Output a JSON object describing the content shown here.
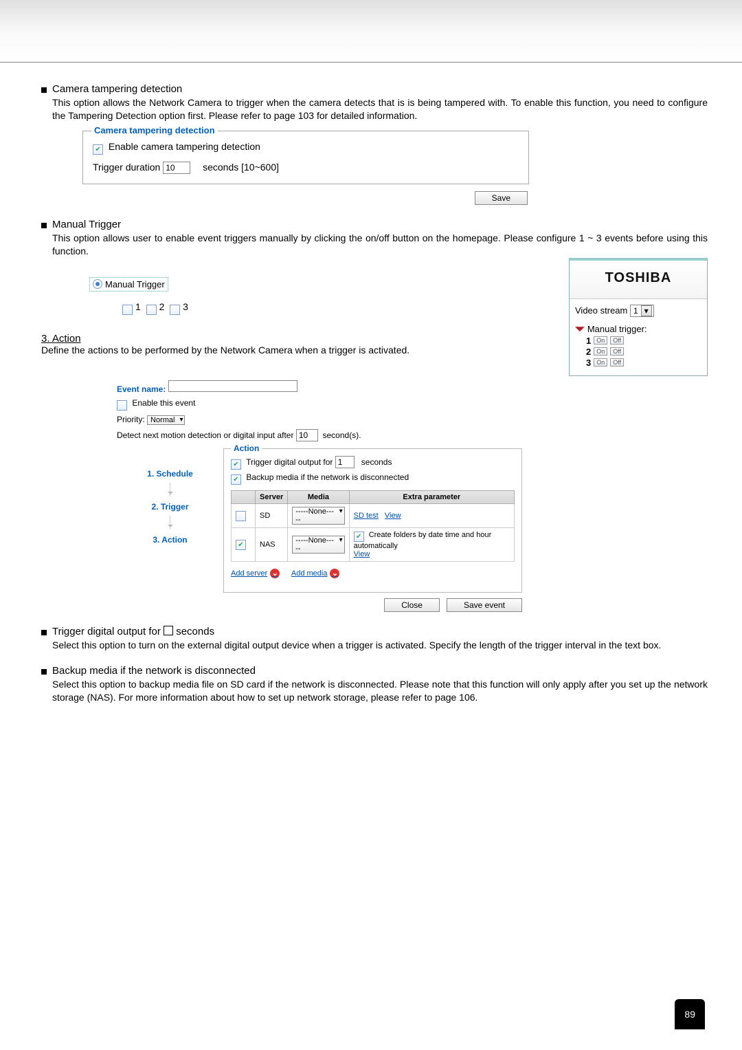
{
  "top_section": {
    "title": "Camera tampering detection",
    "body": "This option allows the Network Camera to trigger when the camera detects that is is being tampered with. To enable this function, you need to configure the Tampering Detection option first. Please refer to page 103 for detailed information."
  },
  "tampering_box": {
    "legend": "Camera tampering detection",
    "enable_label": "Enable camera tampering detection",
    "enable_checked": true,
    "duration_label": "Trigger duration",
    "duration_value": "10",
    "duration_suffix": "seconds [10~600]",
    "save_label": "Save"
  },
  "manual_trigger": {
    "title": "Manual Trigger",
    "body": "This option allows user to enable event triggers manually by clicking the on/off button on the homepage. Please configure 1 ~ 3 events before using this function.",
    "radio_label": "Manual Trigger",
    "numbers": [
      "1",
      "2",
      "3"
    ]
  },
  "action_section": {
    "heading": "3. Action",
    "body": "Define the actions to be performed by the Network Camera when a trigger is activated."
  },
  "side_panel": {
    "brand": "TOSHIBA",
    "video_stream_label": "Video stream",
    "video_stream_value": "1",
    "mt_label": "Manual trigger:",
    "rows": [
      {
        "n": "1",
        "on": "On",
        "off": "Off"
      },
      {
        "n": "2",
        "on": "On",
        "off": "Off"
      },
      {
        "n": "3",
        "on": "On",
        "off": "Off"
      }
    ]
  },
  "event": {
    "name_label": "Event name:",
    "name_value": "",
    "enable_label": "Enable this event",
    "priority_label": "Priority:",
    "priority_value": "Normal",
    "detect_label_pre": "Detect next motion detection or digital input after",
    "detect_value": "10",
    "detect_label_post": "second(s).",
    "steps": {
      "s1": "1.  Schedule",
      "s2": "2.  Trigger",
      "s3": "3.  Action"
    },
    "action_legend": "Action",
    "trigger_out_label": "Trigger digital output for",
    "trigger_out_value": "1",
    "trigger_out_suffix": "seconds",
    "backup_label": "Backup media if the network is disconnected",
    "table": {
      "headers": {
        "server": "Server",
        "media": "Media",
        "extra": "Extra parameter"
      },
      "row_sd": {
        "name": "SD",
        "checked": false,
        "media": "-----None-----",
        "links": {
          "sdtest": "SD test",
          "view": "View"
        }
      },
      "row_nas": {
        "name": "NAS",
        "checked": true,
        "media": "-----None-----",
        "create_label": "Create folders by date time and hour automatically",
        "view": "View"
      }
    },
    "add_server": "Add server",
    "add_media": "Add media",
    "buttons": {
      "close": "Close",
      "save": "Save event"
    }
  },
  "bottom": {
    "do_title_pre": "Trigger digital output for ",
    "do_title_post": " seconds",
    "do_body": "Select this option to turn on the external digital output device when a trigger is activated. Specify the length of the trigger interval in the text box.",
    "bk_title": "Backup media if the network is disconnected",
    "bk_body": "Select this option to backup media file on SD card if the network is disconnected. Please note that this function will only apply after you set up the network storage (NAS). For more information about how to set up network storage, please refer to page 106."
  },
  "page_number": "89"
}
